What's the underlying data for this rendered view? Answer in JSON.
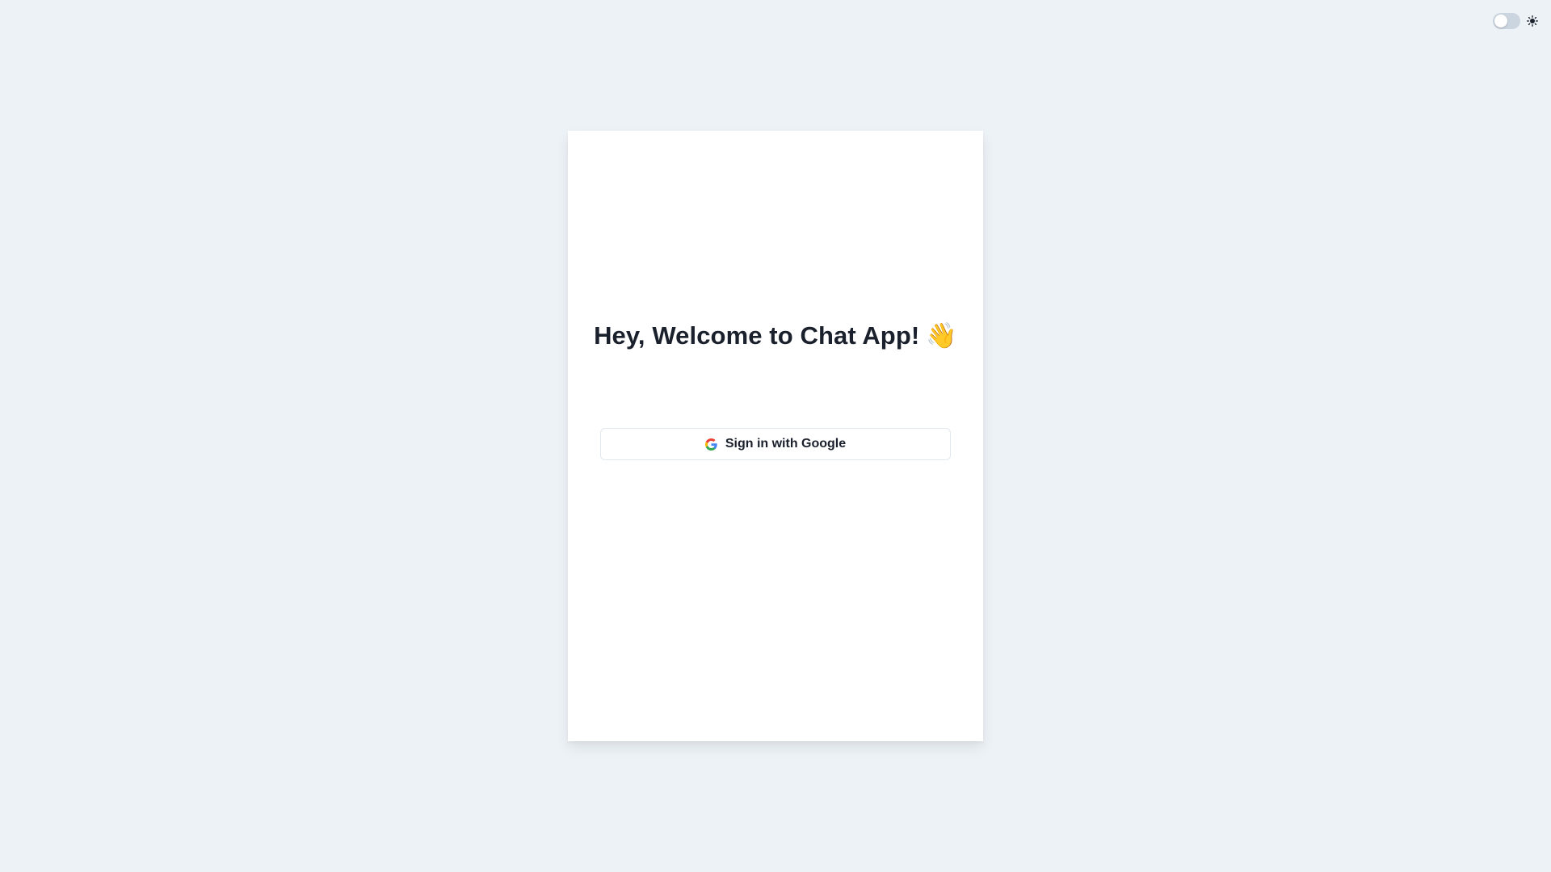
{
  "theme": {
    "toggle_state": "light",
    "icon": "sun-icon"
  },
  "welcome": {
    "title": "Hey, Welcome to Chat App!",
    "emoji": "👋"
  },
  "signin": {
    "google_label": "Sign in with Google",
    "icon": "google-icon"
  },
  "colors": {
    "background": "#edf2f7",
    "card": "#ffffff",
    "text": "#1a202c",
    "border": "#e2e8f0",
    "toggle_track": "#cbd5e0"
  }
}
